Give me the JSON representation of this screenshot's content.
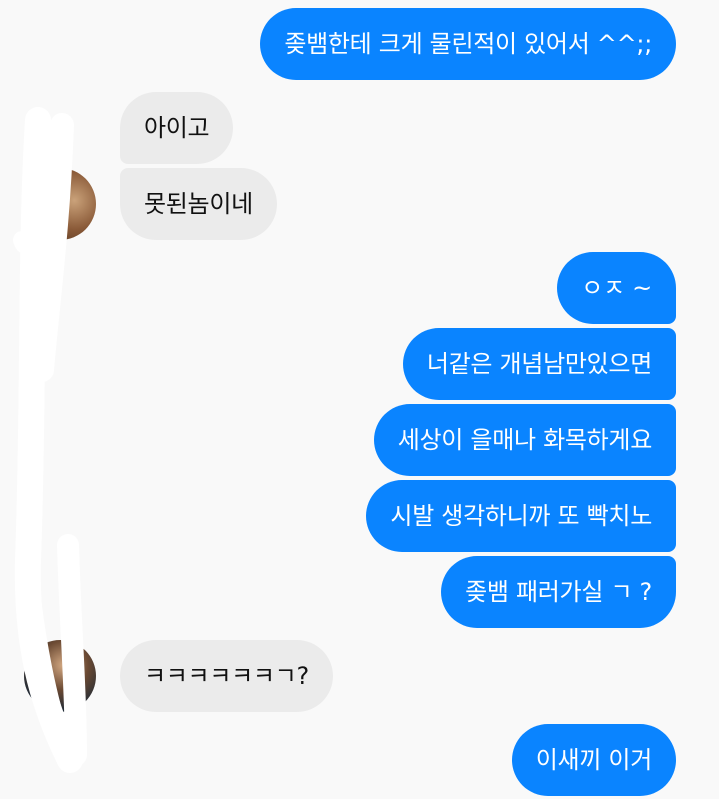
{
  "conversation": {
    "messages": [
      {
        "sender": "me",
        "text": "좆뱀한테 크게 물린적이 있어서 ^^;;"
      },
      {
        "sender": "other",
        "text": "아이고"
      },
      {
        "sender": "other",
        "text": "못된놈이네"
      },
      {
        "sender": "me",
        "text": "ㅇㅈ ~"
      },
      {
        "sender": "me",
        "text": "너같은 개념남만있으면"
      },
      {
        "sender": "me",
        "text": "세상이 을매나 화목하게요"
      },
      {
        "sender": "me",
        "text": "시발 생각하니까 또 빡치노"
      },
      {
        "sender": "me",
        "text": "좆뱀 패러가실 ㄱ ?"
      },
      {
        "sender": "other",
        "text": "ㅋㅋㅋㅋㅋㅋㄱ?"
      },
      {
        "sender": "me",
        "text": "이새끼 이거"
      }
    ]
  },
  "colors": {
    "outgoing_bubble": "#0a84ff",
    "incoming_bubble": "#ebebeb",
    "background": "#f9f9f9",
    "redaction_scribble": "#ffffff"
  }
}
